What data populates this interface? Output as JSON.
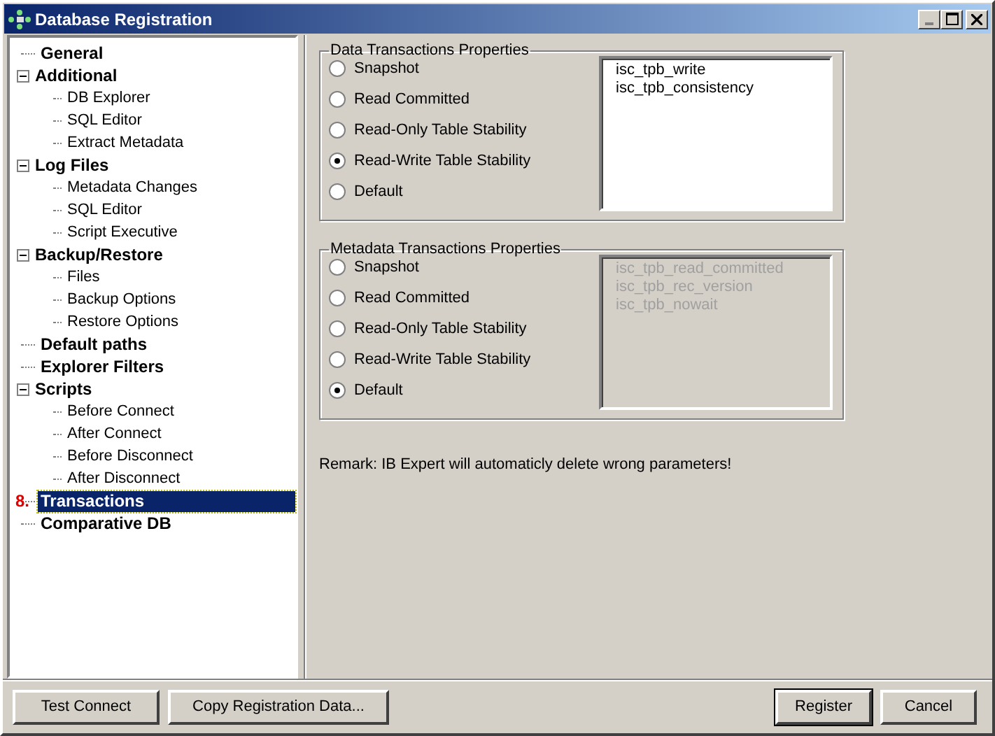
{
  "window": {
    "title": "Database Registration"
  },
  "tree": [
    {
      "label": "General",
      "selected": false
    },
    {
      "label": "Additional",
      "selected": false,
      "expanded": true,
      "children": [
        {
          "label": "DB Explorer",
          "selected": false
        },
        {
          "label": "SQL Editor",
          "selected": false
        },
        {
          "label": "Extract Metadata",
          "selected": false
        }
      ]
    },
    {
      "label": "Log Files",
      "selected": false,
      "expanded": true,
      "children": [
        {
          "label": "Metadata Changes",
          "selected": false
        },
        {
          "label": "SQL Editor",
          "selected": false
        },
        {
          "label": "Script Executive",
          "selected": false
        }
      ]
    },
    {
      "label": "Backup/Restore",
      "selected": false,
      "expanded": true,
      "children": [
        {
          "label": "Files",
          "selected": false
        },
        {
          "label": "Backup Options",
          "selected": false
        },
        {
          "label": "Restore Options",
          "selected": false
        }
      ]
    },
    {
      "label": "Default paths",
      "selected": false
    },
    {
      "label": "Explorer Filters",
      "selected": false
    },
    {
      "label": "Scripts",
      "selected": false,
      "expanded": true,
      "children": [
        {
          "label": "Before Connect",
          "selected": false
        },
        {
          "label": "After Connect",
          "selected": false
        },
        {
          "label": "Before Disconnect",
          "selected": false
        },
        {
          "label": "After Disconnect",
          "selected": false
        }
      ]
    },
    {
      "label": "Transactions",
      "selected": true,
      "marker": "8."
    },
    {
      "label": "Comparative DB",
      "selected": false
    }
  ],
  "groups": [
    {
      "title": "Data Transactions Properties",
      "options": [
        {
          "label": "Snapshot",
          "selected": false
        },
        {
          "label": "Read Committed",
          "selected": false
        },
        {
          "label": "Read-Only Table Stability",
          "selected": false
        },
        {
          "label": "Read-Write Table Stability",
          "selected": true
        },
        {
          "label": "Default",
          "selected": false
        }
      ],
      "params": {
        "disabled": false,
        "lines": [
          "isc_tpb_write",
          "isc_tpb_consistency"
        ]
      }
    },
    {
      "title": "Metadata Transactions Properties",
      "options": [
        {
          "label": "Snapshot",
          "selected": false
        },
        {
          "label": "Read Committed",
          "selected": false
        },
        {
          "label": "Read-Only Table Stability",
          "selected": false
        },
        {
          "label": "Read-Write Table Stability",
          "selected": false
        },
        {
          "label": "Default",
          "selected": true
        }
      ],
      "params": {
        "disabled": true,
        "lines": [
          "isc_tpb_read_committed",
          "isc_tpb_rec_version",
          "isc_tpb_nowait"
        ]
      }
    }
  ],
  "remark": "Remark: IB Expert will automaticly delete wrong parameters!",
  "buttons_left": [
    "Test Connect",
    "Copy Registration Data..."
  ],
  "buttons_right": [
    {
      "label": "Register",
      "default": true
    },
    {
      "label": "Cancel",
      "default": false
    }
  ]
}
